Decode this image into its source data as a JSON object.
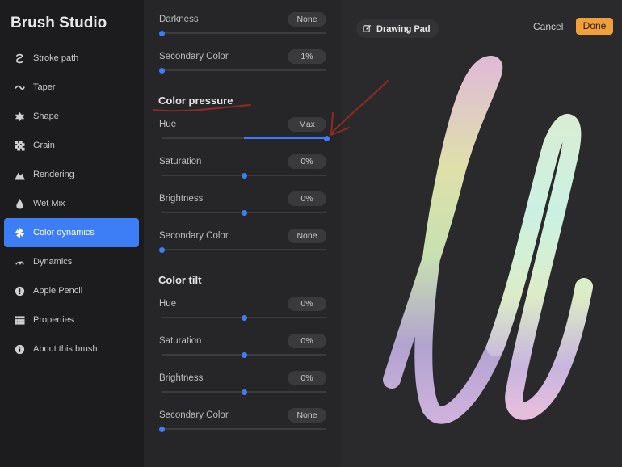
{
  "app_title": "Brush Studio",
  "sidebar": {
    "items": [
      {
        "label": "Stroke path",
        "icon": "stroke-path-icon"
      },
      {
        "label": "Taper",
        "icon": "taper-icon"
      },
      {
        "label": "Shape",
        "icon": "shape-icon"
      },
      {
        "label": "Grain",
        "icon": "grain-icon"
      },
      {
        "label": "Rendering",
        "icon": "rendering-icon"
      },
      {
        "label": "Wet Mix",
        "icon": "wet-mix-icon"
      },
      {
        "label": "Color dynamics",
        "icon": "color-dynamics-icon",
        "active": true
      },
      {
        "label": "Dynamics",
        "icon": "dynamics-icon"
      },
      {
        "label": "Apple Pencil",
        "icon": "apple-pencil-icon"
      },
      {
        "label": "Properties",
        "icon": "properties-icon"
      },
      {
        "label": "About this brush",
        "icon": "about-icon"
      }
    ]
  },
  "panel": {
    "top_rows": [
      {
        "label": "Darkness",
        "value": "None",
        "level": 0
      },
      {
        "label": "Secondary Color",
        "value": "1%",
        "level": 0
      }
    ],
    "color_pressure": {
      "title": "Color pressure",
      "rows": [
        {
          "label": "Hue",
          "value": "Max",
          "level": 1.0
        },
        {
          "label": "Saturation",
          "value": "0%",
          "level": 0.5
        },
        {
          "label": "Brightness",
          "value": "0%",
          "level": 0.5
        },
        {
          "label": "Secondary Color",
          "value": "None",
          "level": 0
        }
      ]
    },
    "color_tilt": {
      "title": "Color tilt",
      "rows": [
        {
          "label": "Hue",
          "value": "0%",
          "level": 0.5
        },
        {
          "label": "Saturation",
          "value": "0%",
          "level": 0.5
        },
        {
          "label": "Brightness",
          "value": "0%",
          "level": 0.5
        },
        {
          "label": "Secondary Color",
          "value": "None",
          "level": 0
        }
      ]
    }
  },
  "canvas": {
    "pad_label": "Drawing Pad",
    "pad_icon": "edit-icon",
    "cancel_label": "Cancel",
    "done_label": "Done"
  },
  "colors": {
    "accent": "#3d7df5",
    "done": "#f0a03a",
    "annotation": "#8e2a24"
  }
}
